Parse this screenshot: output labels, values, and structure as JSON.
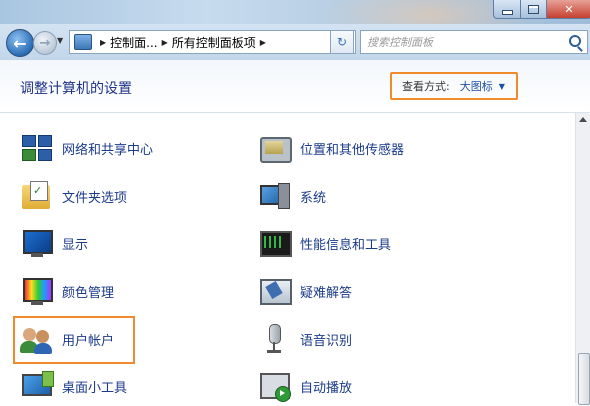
{
  "window": {
    "minimize_glyph": "",
    "maximize_glyph": "",
    "close_glyph": "✕"
  },
  "address": {
    "breadcrumbs": [
      "控制面...",
      "所有控制面板项"
    ],
    "search_placeholder": "搜索控制面板"
  },
  "header": {
    "title": "调整计算机的设置",
    "view_label": "查看方式:",
    "view_value": "大图标"
  },
  "items": {
    "left": [
      {
        "label": "网络和共享中心",
        "icon": "network-center-icon"
      },
      {
        "label": "文件夹选项",
        "icon": "folder-options-icon"
      },
      {
        "label": "显示",
        "icon": "display-icon"
      },
      {
        "label": "颜色管理",
        "icon": "color-management-icon"
      },
      {
        "label": "用户帐户",
        "icon": "user-accounts-icon"
      },
      {
        "label": "桌面小工具",
        "icon": "desktop-gadgets-icon"
      }
    ],
    "right": [
      {
        "label": "位置和其他传感器",
        "icon": "location-sensors-icon"
      },
      {
        "label": "系统",
        "icon": "system-icon"
      },
      {
        "label": "性能信息和工具",
        "icon": "performance-icon"
      },
      {
        "label": "疑难解答",
        "icon": "troubleshooting-icon"
      },
      {
        "label": "语音识别",
        "icon": "speech-recognition-icon"
      },
      {
        "label": "自动播放",
        "icon": "autoplay-icon"
      }
    ]
  },
  "colors": {
    "highlight": "#f08a2a",
    "link": "#1a3a8a",
    "title": "#1e3287"
  }
}
